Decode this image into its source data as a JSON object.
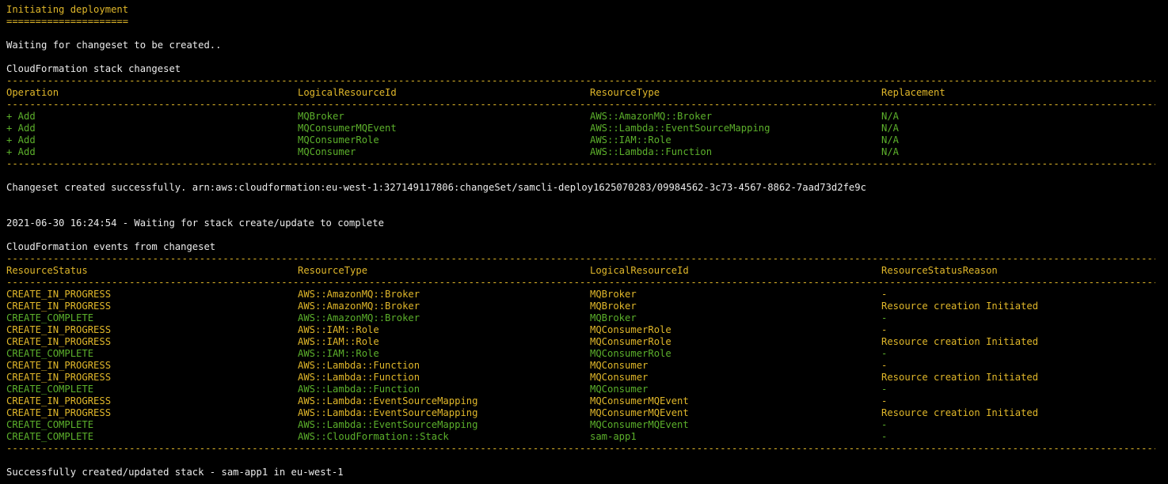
{
  "header": {
    "title": "Initiating deployment",
    "title_underline": "=====================",
    "waiting": "Waiting for changeset to be created.."
  },
  "changeset": {
    "title": "CloudFormation stack changeset",
    "columns": [
      "Operation",
      "LogicalResourceId",
      "ResourceType",
      "Replacement"
    ],
    "rows": [
      [
        "+ Add",
        "MQBroker",
        "AWS::AmazonMQ::Broker",
        "N/A"
      ],
      [
        "+ Add",
        "MQConsumerMQEvent",
        "AWS::Lambda::EventSourceMapping",
        "N/A"
      ],
      [
        "+ Add",
        "MQConsumerRole",
        "AWS::IAM::Role",
        "N/A"
      ],
      [
        "+ Add",
        "MQConsumer",
        "AWS::Lambda::Function",
        "N/A"
      ]
    ],
    "created_message": "Changeset created successfully. arn:aws:cloudformation:eu-west-1:327149117806:changeSet/samcli-deploy1625070283/09984562-3c73-4567-8862-7aad73d2fe9c"
  },
  "wait_message": "2021-06-30 16:24:54 - Waiting for stack create/update to complete",
  "events": {
    "title": "CloudFormation events from changeset",
    "columns": [
      "ResourceStatus",
      "ResourceType",
      "LogicalResourceId",
      "ResourceStatusReason"
    ],
    "rows": [
      [
        "CREATE_IN_PROGRESS",
        "AWS::AmazonMQ::Broker",
        "MQBroker",
        "-"
      ],
      [
        "CREATE_IN_PROGRESS",
        "AWS::AmazonMQ::Broker",
        "MQBroker",
        "Resource creation Initiated"
      ],
      [
        "CREATE_COMPLETE",
        "AWS::AmazonMQ::Broker",
        "MQBroker",
        "-"
      ],
      [
        "CREATE_IN_PROGRESS",
        "AWS::IAM::Role",
        "MQConsumerRole",
        "-"
      ],
      [
        "CREATE_IN_PROGRESS",
        "AWS::IAM::Role",
        "MQConsumerRole",
        "Resource creation Initiated"
      ],
      [
        "CREATE_COMPLETE",
        "AWS::IAM::Role",
        "MQConsumerRole",
        "-"
      ],
      [
        "CREATE_IN_PROGRESS",
        "AWS::Lambda::Function",
        "MQConsumer",
        "-"
      ],
      [
        "CREATE_IN_PROGRESS",
        "AWS::Lambda::Function",
        "MQConsumer",
        "Resource creation Initiated"
      ],
      [
        "CREATE_COMPLETE",
        "AWS::Lambda::Function",
        "MQConsumer",
        "-"
      ],
      [
        "CREATE_IN_PROGRESS",
        "AWS::Lambda::EventSourceMapping",
        "MQConsumerMQEvent",
        "-"
      ],
      [
        "CREATE_IN_PROGRESS",
        "AWS::Lambda::EventSourceMapping",
        "MQConsumerMQEvent",
        "Resource creation Initiated"
      ],
      [
        "CREATE_COMPLETE",
        "AWS::Lambda::EventSourceMapping",
        "MQConsumerMQEvent",
        "-"
      ],
      [
        "CREATE_COMPLETE",
        "AWS::CloudFormation::Stack",
        "sam-app1",
        "-"
      ]
    ]
  },
  "final_message": "Successfully created/updated stack - sam-app1 in eu-west-1",
  "colors": {
    "background": "#000000",
    "text": "#ececec",
    "in_progress": "#e0b72a",
    "complete": "#5cb02b"
  }
}
